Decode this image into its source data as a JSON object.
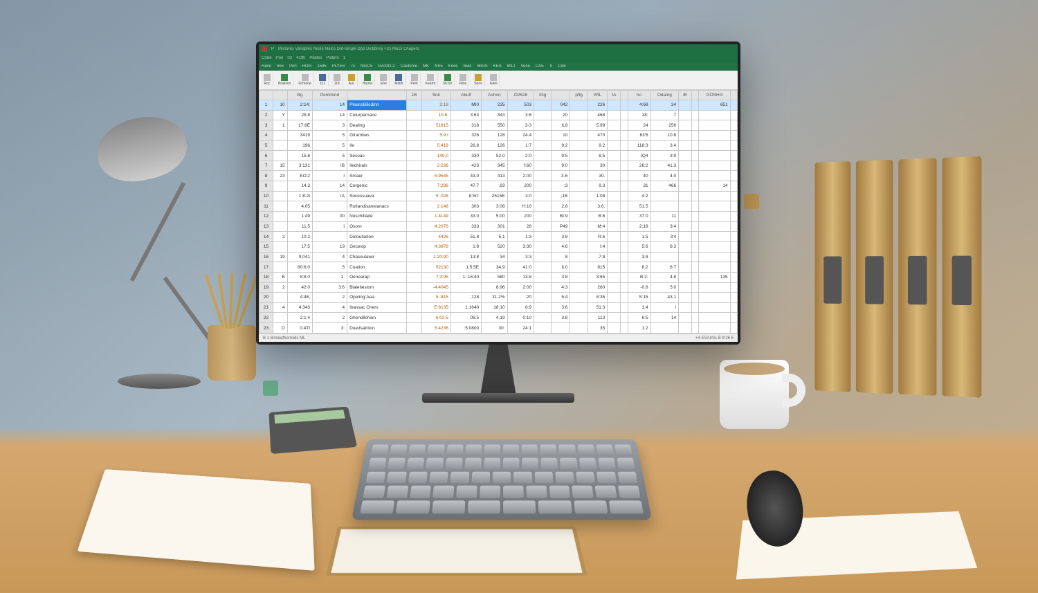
{
  "app": {
    "icon_letter": "P",
    "title_items": [
      "Mixtures",
      "Variables",
      "Nices",
      "Malcs",
      "Dot-Single",
      "Dpp",
      "Dictibinry",
      "F2s",
      "Mocs",
      "Chapers"
    ],
    "menu_items": [
      "Crate",
      "Poo",
      "02",
      "4190",
      "Pilates",
      "Plcters",
      "1"
    ],
    "tabs": [
      "Have",
      "Irex",
      "Pon",
      "ROG",
      "1595",
      "PLYES",
      "7x",
      "NGCS",
      "GAX91:2",
      "Cauforce",
      "MK",
      "NS5",
      "Koes",
      "Nias",
      "MIGS",
      "KES",
      "M12",
      "Vece",
      "CAE",
      "X",
      "Cxlc"
    ]
  },
  "ribbon": [
    {
      "label": "Roc"
    },
    {
      "label": "Bratison"
    },
    {
      "label": "Frimone"
    },
    {
      "label": "311"
    },
    {
      "label": "118"
    },
    {
      "label": "Aur"
    },
    {
      "label": "Harms"
    },
    {
      "label": "Ehe"
    },
    {
      "label": "Mstih"
    },
    {
      "label": "Pent"
    },
    {
      "label": "Kearnt"
    },
    {
      "label": "56:59"
    },
    {
      "label": "Rtos"
    },
    {
      "label": "Snos"
    },
    {
      "label": "Ieleri"
    }
  ],
  "columns": [
    "",
    "",
    "Bg",
    "Pentmind",
    "",
    "1B",
    "Snk",
    "Akulf",
    "Ashon",
    "O2628",
    "IGg",
    "",
    "pflg",
    "WIL",
    "IA",
    "",
    "ho",
    "Odaing",
    "IE",
    "",
    "GOSHG",
    ""
  ],
  "rows": [
    {
      "sel": true,
      "a": "10",
      "b": "2:14;",
      "c": "14",
      "name": "PleansBilcdinn",
      "v1": "2:18",
      "v2": "MI0",
      "v3": "235",
      "v4": "503",
      "v5": "042",
      "v6": "226",
      "v7": "4:68",
      "v8": "34",
      "v9": "651"
    },
    {
      "a": "Y",
      "b": "25:8",
      "c": "14",
      "name": "Colurparnace",
      "v1": "10:6.",
      "v2": "3:63",
      "v3": "343",
      "v4": "3:6",
      "v5": "20",
      "v6": "468",
      "v7": "18:",
      "v8": "7",
      "v9": ""
    },
    {
      "a": "1",
      "b": "17:6E",
      "c": "3",
      "name": "Dealing",
      "v1": "51815",
      "v2": "318",
      "v3": "550",
      "v4": "3-3",
      "v5": "IL8",
      "v6": "5.99",
      "v7": "24",
      "v8": "256",
      "v9": ""
    },
    {
      "a": "",
      "b": "3419",
      "c": "5",
      "name": "Gtrambes",
      "v1": "5:9.t",
      "v2": "326",
      "v3": "128",
      "v4": "24.4",
      "v5": "10",
      "v6": "470",
      "v7": "63'6",
      "v8": "10.8",
      "v9": ""
    },
    {
      "a": "",
      "b": "196",
      "c": "5",
      "name": "Ile",
      "v1": "5:418",
      "v2": "26.8",
      "v3": "126",
      "v4": "1:7",
      "v5": "9:2",
      "v6": "9.2",
      "v7": "118:3",
      "v8": "3.4",
      "v9": ""
    },
    {
      "a": "",
      "b": "15.6",
      "c": "5",
      "name": "Sesoac",
      "v1": "149,0",
      "v2": "330",
      "v3": "52.0",
      "v4": "2:0",
      "v5": "9:5",
      "v6": "8.5",
      "v7": "IQ4",
      "v8": "3:9",
      "v9": ""
    },
    {
      "a": "15",
      "b": "3:131",
      "c": "IB",
      "name": "Ilechirals",
      "v1": "2:236",
      "v2": "423",
      "v3": "345",
      "v4": "f:60",
      "v5": "9:0",
      "v6": "30",
      "v7": "26:2",
      "v8": "41.3",
      "v9": ""
    },
    {
      "a": "23",
      "b": "EO:2",
      "c": "I",
      "name": "Smaer",
      "v1": "5:9545",
      "v2": "43,0",
      "v3": "413",
      "v4": "2:00",
      "v5": "3-6",
      "v6": "30.",
      "v7": "40",
      "v8": "4.0",
      "v9": ""
    },
    {
      "a": "",
      "b": "14.3",
      "c": "14",
      "name": "Corgenic",
      "v1": "7:296",
      "v2": "47.7",
      "v3": ".93",
      "v4": "200",
      "v5": ";3",
      "v6": "9.3",
      "v7": "31",
      "v8": "466",
      "v9": "14"
    },
    {
      "a": "",
      "b": "1:8:2t",
      "c": "IA",
      "name": "Socessuava",
      "v1": "5:.028",
      "v2": "8:50:",
      "v3": "2515E",
      "v4": "3:0",
      "v5": ";1B",
      "v6": "1:08",
      "v7": "4:2",
      "v8": "",
      "v9": ""
    },
    {
      "a": "",
      "b": "4.05",
      "c": "",
      "name": "Rutlandisanelanacs",
      "v1": "2:148",
      "v2": "303",
      "v3": "3:08",
      "v4": "H:10",
      "v5": "2:8",
      "v6": "3:6.",
      "v7": "51.5",
      "v8": "",
      "v9": ""
    },
    {
      "a": "",
      "b": "1:49",
      "c": "00",
      "name": "Noschillade",
      "v1": "1:4L49",
      "v2": "33.0",
      "v3": "5:00",
      "v4": "200",
      "v5": "BI:9",
      "v6": "B:6",
      "v7": "37:0",
      "v8": "11",
      "v9": ""
    },
    {
      "a": "",
      "b": "11.5",
      "c": "I",
      "name": "Osorn",
      "v1": "4:2076",
      "v2": "333",
      "v3": "301",
      "v4": "28",
      "v5": "P49",
      "v6": "M:4",
      "v7": "2:18",
      "v8": "3:4",
      "v9": ""
    },
    {
      "a": "3",
      "b": "10:2",
      "c": "",
      "name": "Dutoutiation",
      "v1": "4426",
      "v2": "51.8",
      "v3": "5.1",
      "v4": "1:3",
      "v5": "3:8",
      "v6": "R:6",
      "v7": "1:5",
      "v8": "3'4",
      "v9": ""
    },
    {
      "a": "",
      "b": "17.5",
      "c": "19",
      "name": "Gecexip",
      "v1": "4:3979",
      "v2": "1:8",
      "v3": "520",
      "v4": "3:30",
      "v5": "4:6",
      "v6": "I:4",
      "v7": "5:6",
      "v8": "6:3",
      "v9": ""
    },
    {
      "a": "19",
      "b": "9;041",
      "c": "4",
      "name": "Chaceulawir",
      "v1": "1:20:90",
      "v2": "13:8",
      "v3": "34",
      "v4": "3:3",
      "v5": "8",
      "v6": "7:8",
      "v7": "3:8",
      "v8": "",
      "v9": ""
    },
    {
      "a": "",
      "b": "80:6:0",
      "c": "5",
      "name": "Coation",
      "v1": "52130",
      "v2": "1:5;5E",
      "v3": "34,9",
      "v4": "41:0",
      "v5": "IL0",
      "v6": "815",
      "v7": "8:2",
      "v8": "6:7",
      "v9": ""
    },
    {
      "a": "B",
      "b": "8:8.0",
      "c": "1.",
      "name": "Oenearap",
      "v1": "7:3:95",
      "v2": "1:.16:40",
      "v3": "580",
      "v4": "13:8",
      "v5": "3:8",
      "v6": "3:65",
      "v7": "B:2:",
      "v8": "4.8",
      "v9": "135"
    },
    {
      "a": "2",
      "b": "42:0",
      "c": "3:6",
      "name": "Blaletiestom",
      "v1": "-4:4045",
      "v2": "",
      "v3": "8:96",
      "v4": "2:00",
      "v5": "4:3",
      "v6": "260",
      "v7": "-0:8",
      "v8": "5:0",
      "v9": ""
    },
    {
      "a": "",
      "b": "4:46;",
      "c": "2",
      "name": "Opeling:Aea",
      "v1": "5::815",
      "v2": ";128",
      "v3": "31.2%",
      "v4": ":20",
      "v5": "5:4",
      "v6": "8:35",
      "v7": "S:15",
      "v8": "43.1",
      "v9": ""
    },
    {
      "a": "4",
      "b": "4:343",
      "c": "4",
      "name": "Ibassac Chers",
      "v1": "E:8135",
      "v2": "1:1640",
      "v3": "18:10",
      "v4": "8:9",
      "v5": "3:6",
      "v6": "51:3",
      "v7": "1:4",
      "v8": "i",
      "v9": ""
    },
    {
      "a": "",
      "b": "2:1:4",
      "c": "2",
      "name": "Ghendilchion",
      "v1": "6:02:5",
      "v2": "08.5",
      "v3": "4,19",
      "v4": "0:10",
      "v5": "3:8",
      "v6": "113",
      "v7": "6:5",
      "v8": "14",
      "v9": ""
    },
    {
      "a": "O",
      "b": "0:4TI",
      "c": "3:",
      "name": "Duedsatrlion",
      "v1": "5:4236",
      "v2": ":5:0800",
      "v3": "30:",
      "v4": "24:1",
      "v5": "",
      "v6": "35",
      "v7": "1:2",
      "v8": "",
      "v9": ""
    }
  ],
  "status": {
    "left": "B 1 8imalafhormids ML",
    "right": "+4 ESAIAIL  B  9:26  6"
  }
}
